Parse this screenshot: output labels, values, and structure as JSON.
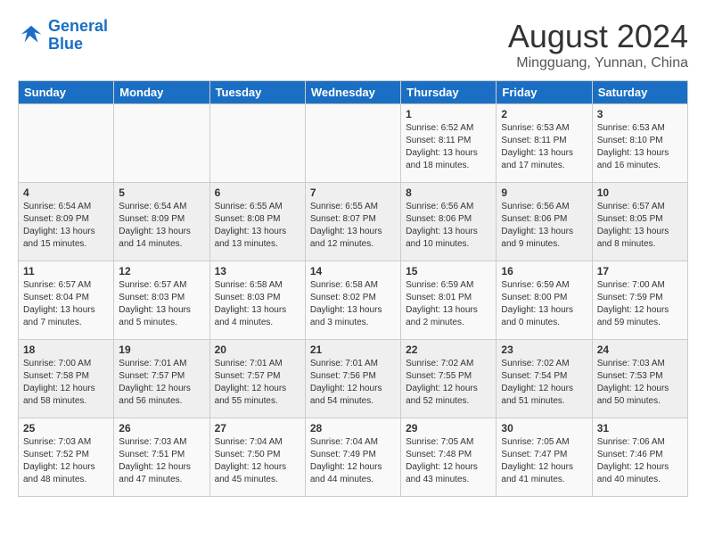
{
  "logo": {
    "line1": "General",
    "line2": "Blue"
  },
  "title": "August 2024",
  "location": "Mingguang, Yunnan, China",
  "days_of_week": [
    "Sunday",
    "Monday",
    "Tuesday",
    "Wednesday",
    "Thursday",
    "Friday",
    "Saturday"
  ],
  "weeks": [
    [
      {
        "day": "",
        "info": ""
      },
      {
        "day": "",
        "info": ""
      },
      {
        "day": "",
        "info": ""
      },
      {
        "day": "",
        "info": ""
      },
      {
        "day": "1",
        "info": "Sunrise: 6:52 AM\nSunset: 8:11 PM\nDaylight: 13 hours\nand 18 minutes."
      },
      {
        "day": "2",
        "info": "Sunrise: 6:53 AM\nSunset: 8:11 PM\nDaylight: 13 hours\nand 17 minutes."
      },
      {
        "day": "3",
        "info": "Sunrise: 6:53 AM\nSunset: 8:10 PM\nDaylight: 13 hours\nand 16 minutes."
      }
    ],
    [
      {
        "day": "4",
        "info": "Sunrise: 6:54 AM\nSunset: 8:09 PM\nDaylight: 13 hours\nand 15 minutes."
      },
      {
        "day": "5",
        "info": "Sunrise: 6:54 AM\nSunset: 8:09 PM\nDaylight: 13 hours\nand 14 minutes."
      },
      {
        "day": "6",
        "info": "Sunrise: 6:55 AM\nSunset: 8:08 PM\nDaylight: 13 hours\nand 13 minutes."
      },
      {
        "day": "7",
        "info": "Sunrise: 6:55 AM\nSunset: 8:07 PM\nDaylight: 13 hours\nand 12 minutes."
      },
      {
        "day": "8",
        "info": "Sunrise: 6:56 AM\nSunset: 8:06 PM\nDaylight: 13 hours\nand 10 minutes."
      },
      {
        "day": "9",
        "info": "Sunrise: 6:56 AM\nSunset: 8:06 PM\nDaylight: 13 hours\nand 9 minutes."
      },
      {
        "day": "10",
        "info": "Sunrise: 6:57 AM\nSunset: 8:05 PM\nDaylight: 13 hours\nand 8 minutes."
      }
    ],
    [
      {
        "day": "11",
        "info": "Sunrise: 6:57 AM\nSunset: 8:04 PM\nDaylight: 13 hours\nand 7 minutes."
      },
      {
        "day": "12",
        "info": "Sunrise: 6:57 AM\nSunset: 8:03 PM\nDaylight: 13 hours\nand 5 minutes."
      },
      {
        "day": "13",
        "info": "Sunrise: 6:58 AM\nSunset: 8:03 PM\nDaylight: 13 hours\nand 4 minutes."
      },
      {
        "day": "14",
        "info": "Sunrise: 6:58 AM\nSunset: 8:02 PM\nDaylight: 13 hours\nand 3 minutes."
      },
      {
        "day": "15",
        "info": "Sunrise: 6:59 AM\nSunset: 8:01 PM\nDaylight: 13 hours\nand 2 minutes."
      },
      {
        "day": "16",
        "info": "Sunrise: 6:59 AM\nSunset: 8:00 PM\nDaylight: 13 hours\nand 0 minutes."
      },
      {
        "day": "17",
        "info": "Sunrise: 7:00 AM\nSunset: 7:59 PM\nDaylight: 12 hours\nand 59 minutes."
      }
    ],
    [
      {
        "day": "18",
        "info": "Sunrise: 7:00 AM\nSunset: 7:58 PM\nDaylight: 12 hours\nand 58 minutes."
      },
      {
        "day": "19",
        "info": "Sunrise: 7:01 AM\nSunset: 7:57 PM\nDaylight: 12 hours\nand 56 minutes."
      },
      {
        "day": "20",
        "info": "Sunrise: 7:01 AM\nSunset: 7:57 PM\nDaylight: 12 hours\nand 55 minutes."
      },
      {
        "day": "21",
        "info": "Sunrise: 7:01 AM\nSunset: 7:56 PM\nDaylight: 12 hours\nand 54 minutes."
      },
      {
        "day": "22",
        "info": "Sunrise: 7:02 AM\nSunset: 7:55 PM\nDaylight: 12 hours\nand 52 minutes."
      },
      {
        "day": "23",
        "info": "Sunrise: 7:02 AM\nSunset: 7:54 PM\nDaylight: 12 hours\nand 51 minutes."
      },
      {
        "day": "24",
        "info": "Sunrise: 7:03 AM\nSunset: 7:53 PM\nDaylight: 12 hours\nand 50 minutes."
      }
    ],
    [
      {
        "day": "25",
        "info": "Sunrise: 7:03 AM\nSunset: 7:52 PM\nDaylight: 12 hours\nand 48 minutes."
      },
      {
        "day": "26",
        "info": "Sunrise: 7:03 AM\nSunset: 7:51 PM\nDaylight: 12 hours\nand 47 minutes."
      },
      {
        "day": "27",
        "info": "Sunrise: 7:04 AM\nSunset: 7:50 PM\nDaylight: 12 hours\nand 45 minutes."
      },
      {
        "day": "28",
        "info": "Sunrise: 7:04 AM\nSunset: 7:49 PM\nDaylight: 12 hours\nand 44 minutes."
      },
      {
        "day": "29",
        "info": "Sunrise: 7:05 AM\nSunset: 7:48 PM\nDaylight: 12 hours\nand 43 minutes."
      },
      {
        "day": "30",
        "info": "Sunrise: 7:05 AM\nSunset: 7:47 PM\nDaylight: 12 hours\nand 41 minutes."
      },
      {
        "day": "31",
        "info": "Sunrise: 7:06 AM\nSunset: 7:46 PM\nDaylight: 12 hours\nand 40 minutes."
      }
    ]
  ]
}
